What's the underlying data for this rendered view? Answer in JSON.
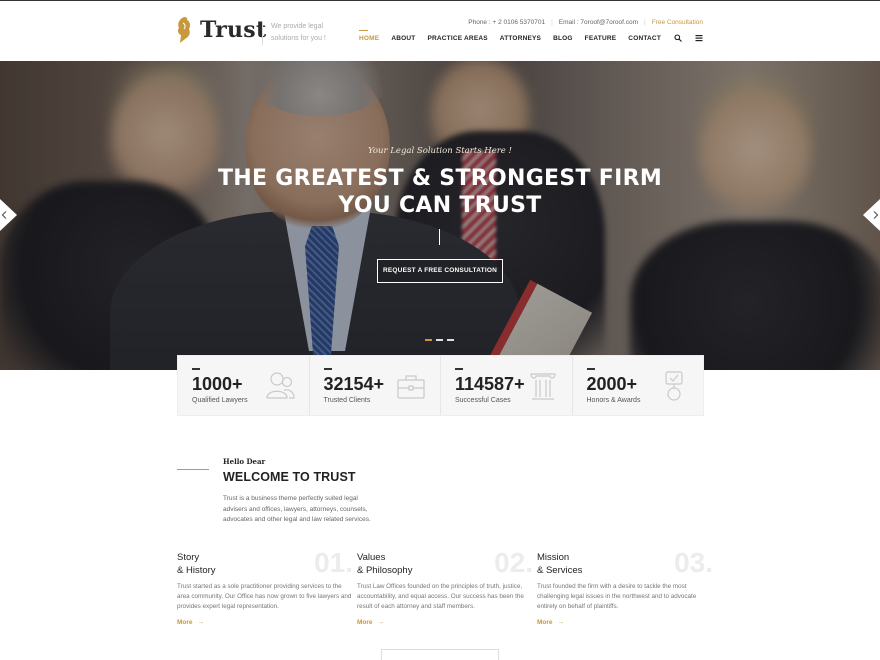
{
  "brand": {
    "name": "Trust",
    "tagline": "We provide legal solutions for you !"
  },
  "topbar": {
    "phone": "Phone : + 2 0106 5370701",
    "email": "Email : 7oroof@7oroof.com",
    "cta": "Free Consultation"
  },
  "nav": {
    "items": [
      "HOME",
      "ABOUT",
      "PRACTICE AREAS",
      "ATTORNEYS",
      "BLOG",
      "FEATURE",
      "CONTACT"
    ],
    "active": "HOME"
  },
  "hero": {
    "subtitle": "Your Legal Solution Starts Here !",
    "title_line1": "THE GREATEST & STRONGEST FIRM",
    "title_line2": "YOU CAN TRUST",
    "button": "REQUEST A FREE CONSULTATION"
  },
  "stats": [
    {
      "value": "1000+",
      "label": "Qualified Lawyers",
      "icon": "lawyers-icon"
    },
    {
      "value": "32154+",
      "label": "Trusted Clients",
      "icon": "briefcase-icon"
    },
    {
      "value": "114587+",
      "label": "Successful Cases",
      "icon": "pillar-icon"
    },
    {
      "value": "2000+",
      "label": "Honors & Awards",
      "icon": "award-icon"
    }
  ],
  "welcome": {
    "kicker": "Hello Dear",
    "title": "WELCOME TO TRUST",
    "desc": "Trust is a business theme perfectly suited legal advisers and offices, lawyers, attorneys, counsels, advocates and other legal and law related services."
  },
  "columns": [
    {
      "num": "01.",
      "title1": "Story",
      "title2": "& History",
      "text": "Trust started as a sole practitioner providing services to the area community. Our Office has now grown to five lawyers and provides expert legal representation.",
      "more": "More"
    },
    {
      "num": "02.",
      "title1": "Values",
      "title2": "& Philosophy",
      "text": "Trust Law Offices founded on the principles of truth, justice, accountability, and equal access. Our success has been the result of each attorney and staff members.",
      "more": "More"
    },
    {
      "num": "03.",
      "title1": "Mission",
      "title2": "& Services",
      "text": "Trust founded the firm with a desire to tackle the most challenging legal issues in the northwest and to advocate entirely on behalf of plaintiffs.",
      "more": "More"
    }
  ],
  "colors": {
    "accent": "#c8983a",
    "dark": "#222222"
  }
}
